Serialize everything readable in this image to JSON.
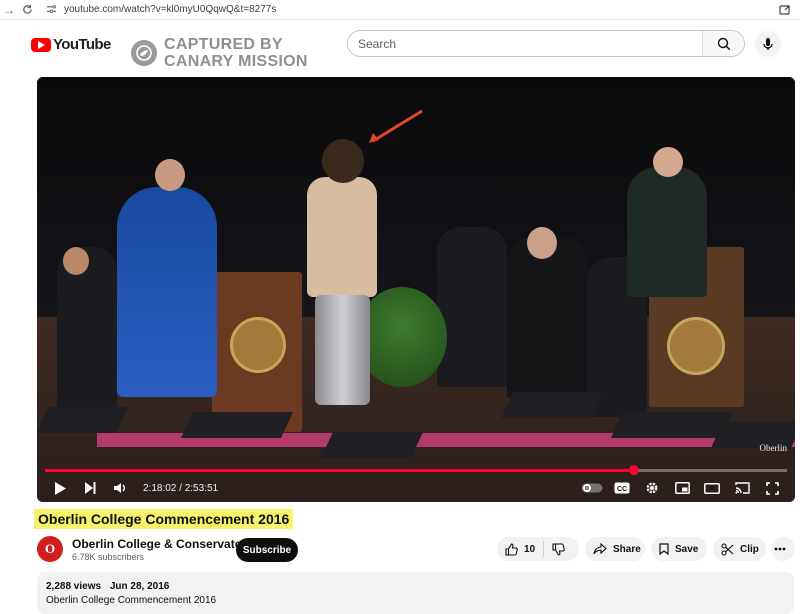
{
  "browser": {
    "url": "youtube.com/watch?v=kl0myU0QqwQ&t=8277s"
  },
  "header": {
    "logo_text": "YouTube",
    "watermark_line1": "CAPTURED BY",
    "watermark_line2": "CANARY MISSION",
    "search_placeholder": "Search"
  },
  "player": {
    "current_time": "2:18:02",
    "duration": "2:53:51",
    "timecode": "2:18:02 / 2:53:51",
    "progress_fraction": 0.794,
    "watermark": "Oberlin"
  },
  "video": {
    "title": "Oberlin College Commencement 2016"
  },
  "channel": {
    "avatar_letter": "O",
    "name": "Oberlin College & Conservatory",
    "subscribers": "6.78K subscribers",
    "subscribe_label": "Subscribe"
  },
  "actions": {
    "like_count": "10",
    "share_label": "Share",
    "save_label": "Save",
    "clip_label": "Clip"
  },
  "description": {
    "views": "2,288 views",
    "date": "Jun 28, 2016",
    "text": "Oberlin College Commencement 2016"
  },
  "colors": {
    "brand_red": "#ff0000",
    "progress": "#ff0033",
    "title_highlight": "#f7f26a"
  }
}
